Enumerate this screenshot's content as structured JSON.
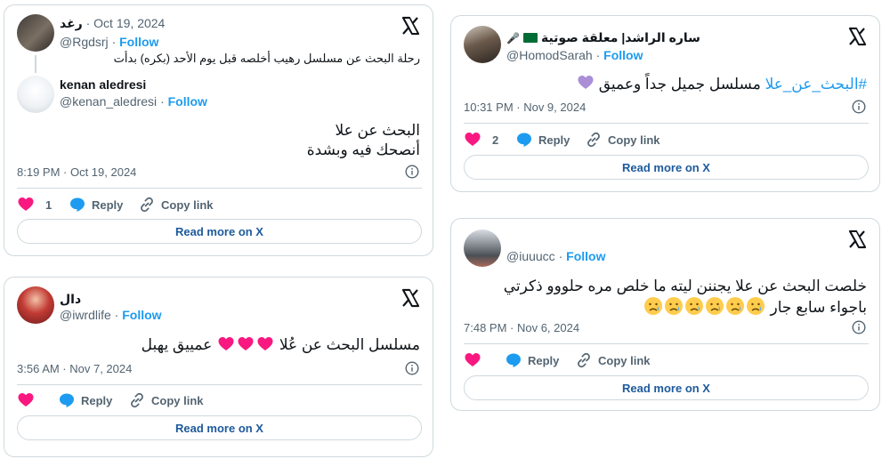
{
  "tweets": [
    {
      "quoted": {
        "name": "رغد",
        "date": "Oct 19, 2024",
        "handle": "@Rgdsrj",
        "text": "رحلة البحث عن مسلسل رهيب أخلصه قبل يوم الأحد (بكره) بدأت"
      },
      "name": "kenan aledresi",
      "handle": "@kenan_aledresi",
      "follow": "Follow",
      "text_line1": "البحث عن علا",
      "text_line2": "أنصحك فيه وبشدة",
      "timestamp": "8:19 PM · Oct 19, 2024",
      "likes": "1",
      "reply": "Reply",
      "copy": "Copy link",
      "read_more": "Read more on X"
    },
    {
      "name": "دال",
      "handle": "@iwrdlife",
      "follow": "Follow",
      "text": "مسلسل البحث عن عُلا",
      "text_tail": "عمييق يهبل",
      "timestamp": "3:56 AM · Nov 7, 2024",
      "reply": "Reply",
      "copy": "Copy link",
      "read_more": "Read more on X"
    },
    {
      "name": "ساره الراشد| معلقة صوتية",
      "handle": "@HomodSarah",
      "follow": "Follow",
      "hashtag": "#البحث_عن_علا",
      "text": "مسلسل جميل جداً وعميق",
      "timestamp": "10:31 PM · Nov 9, 2024",
      "likes": "2",
      "reply": "Reply",
      "copy": "Copy link",
      "read_more": "Read more on X"
    },
    {
      "handle": "@iuuucc",
      "follow": "Follow",
      "text_line1": "خلصت البحث عن علا  يجننن ليته ما خلص مره حلووو ذكرتي",
      "text_line2": "باجواء سابع جار",
      "timestamp": "7:48 PM · Nov 6, 2024",
      "reply": "Reply",
      "copy": "Copy link",
      "read_more": "Read more on X"
    }
  ],
  "colors": {
    "like": "#f91880",
    "reply": "#1d9bf0",
    "follow": "#1d9bf0",
    "border": "#cfd9de",
    "readmore": "#1d5a9c"
  }
}
